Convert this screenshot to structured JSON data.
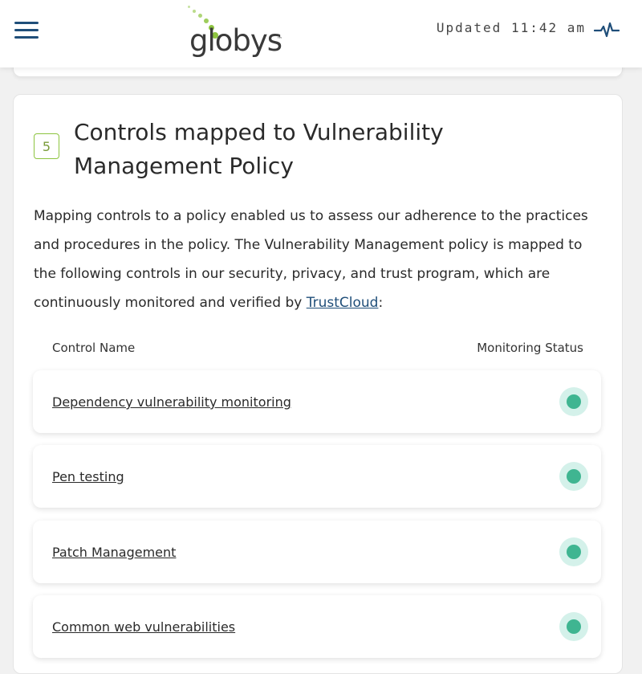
{
  "header": {
    "logo_text": "globys",
    "logo_tm": "™",
    "updated_text": "Updated 11:42 am",
    "pulse_icon": "activity-pulse-icon",
    "menu_icon": "hamburger-menu-icon"
  },
  "section": {
    "step_number": "5",
    "title": "Controls mapped to Vulnerability Management Policy",
    "description_prefix": "Mapping controls to a policy enabled us to assess our adherence to the practices and procedures in the policy. The Vulnerability Management policy is mapped to the following controls in our security, privacy, and trust program, which are continuously monitored and verified by ",
    "description_link": "TrustCloud",
    "description_suffix": ":",
    "columns": {
      "name": "Control Name",
      "status": "Monitoring Status"
    },
    "controls": [
      {
        "name": "Dependency vulnerability monitoring",
        "status": "monitored"
      },
      {
        "name": "Pen testing",
        "status": "monitored"
      },
      {
        "name": "Patch Management",
        "status": "monitored"
      },
      {
        "name": "Common web vulnerabilities",
        "status": "monitored"
      }
    ]
  },
  "colors": {
    "brand_navy": "#1f4e79",
    "brand_green": "#8dc43f",
    "status_green": "#3fb591",
    "status_halo": "#d4f1ea"
  }
}
